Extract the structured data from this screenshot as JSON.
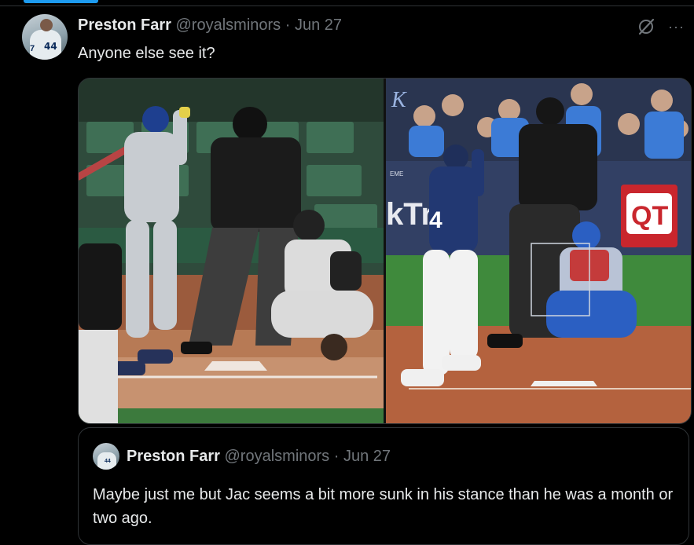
{
  "post": {
    "author_name": "Preston Farr",
    "author_handle": "@royalsminors",
    "separator": "·",
    "date": "Jun 27",
    "text": "Anyone else see it?",
    "avatar_number": "44",
    "avatar_number_left": "7",
    "icons": {
      "grok": "grok-slash-circle-icon",
      "more": "more-options-icon"
    },
    "more_glyph": "···"
  },
  "media": {
    "left_panel": {
      "description_icon": "baseball-batter-photo-left"
    },
    "right_panel": {
      "sign_text": "QT",
      "banner_text": "kTri",
      "small_text": "EME",
      "crest_text": "K",
      "jersey_number": "4"
    }
  },
  "quoted_post": {
    "author_name": "Preston Farr",
    "author_handle": "@royalsminors",
    "separator": "·",
    "date": "Jun 27",
    "avatar_number": "44",
    "text": "Maybe just me but Jac seems a bit more sunk in his stance than he was a month or two ago."
  },
  "colors": {
    "background": "#000000",
    "text_primary": "#e7e9ea",
    "text_secondary": "#71767b",
    "border": "#2f3336",
    "accent": "#1d9bf0"
  }
}
